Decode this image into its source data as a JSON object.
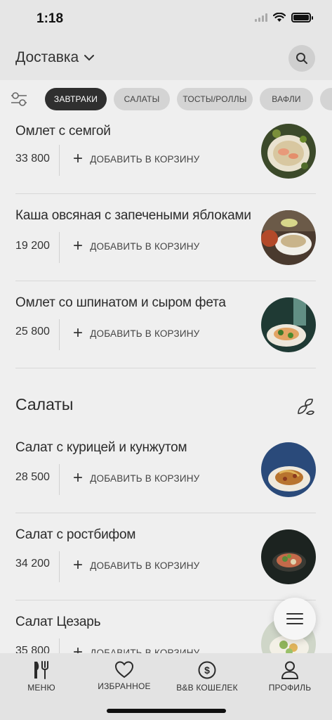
{
  "status_bar": {
    "time": "1:18"
  },
  "header": {
    "delivery_label": "Доставка"
  },
  "filters": {
    "chips": [
      {
        "label": "ЗАВТРАКИ",
        "active": true
      },
      {
        "label": "САЛАТЫ",
        "active": false
      },
      {
        "label": "ТОСТЫ/РОЛЛЫ",
        "active": false
      },
      {
        "label": "ВАФЛИ",
        "active": false
      },
      {
        "label": "",
        "active": false
      }
    ]
  },
  "add_to_cart_label": "ДОБАВИТЬ В КОРЗИНУ",
  "items": [
    {
      "name": "Омлет с семгой",
      "price": "33 800"
    },
    {
      "name": "Каша овсяная с запечеными яблоками",
      "price": "19 200"
    },
    {
      "name": "Омлет со шпинатом и сыром фета",
      "price": "25 800"
    },
    {
      "name": "Салат с курицей и кунжутом",
      "price": "28 500"
    },
    {
      "name": "Салат с ростбифом",
      "price": "34 200"
    },
    {
      "name": "Салат Цезарь",
      "price": "35 800"
    }
  ],
  "section": {
    "title": "Салаты",
    "icon": "leaves-icon"
  },
  "tabbar": {
    "tabs": [
      {
        "label": "МЕНЮ",
        "icon": "cutlery-icon"
      },
      {
        "label": "ИЗБРАННОЕ",
        "icon": "heart-icon"
      },
      {
        "label": "B&B КОШЕЛЕК",
        "icon": "dollar-coin-icon"
      },
      {
        "label": "ПРОФИЛЬ",
        "icon": "profile-icon"
      }
    ]
  }
}
